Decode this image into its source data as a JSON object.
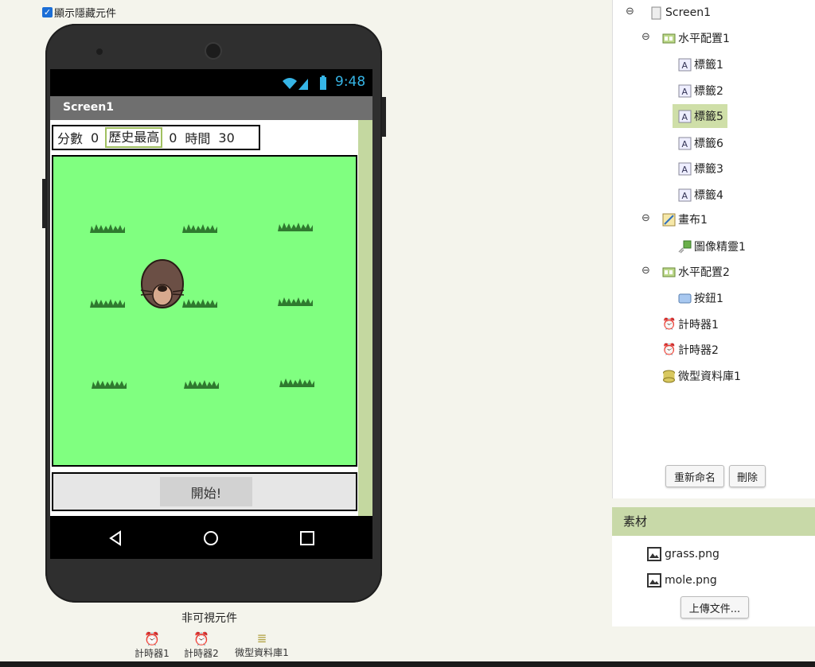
{
  "show_hidden": {
    "label": "顯示隱藏元件",
    "checked": true
  },
  "phone": {
    "status_time": "9:48",
    "screen_title": "Screen1",
    "labels": [
      "分數",
      "0",
      "歷史最高",
      "0",
      "時間",
      "30"
    ],
    "start_button": "開始!"
  },
  "nonvisible": {
    "title": "非可視元件",
    "items": [
      "計時器1",
      "計時器2",
      "微型資料庫1"
    ]
  },
  "tree": {
    "items": [
      "Screen1",
      "水平配置1",
      "標籤1",
      "標籤2",
      "標籤5",
      "標籤6",
      "標籤3",
      "標籤4",
      "畫布1",
      "圖像精靈1",
      "水平配置2",
      "按鈕1",
      "計時器1",
      "計時器2",
      "微型資料庫1"
    ],
    "rename_button": "重新命名",
    "delete_button": "刪除"
  },
  "assets": {
    "title": "素材",
    "files": [
      "grass.png",
      "mole.png"
    ],
    "upload_button": "上傳文件..."
  },
  "colors": {
    "canvas": "#80ff80",
    "accent": "#c8d9a8",
    "selection": "#cfdfa8"
  }
}
